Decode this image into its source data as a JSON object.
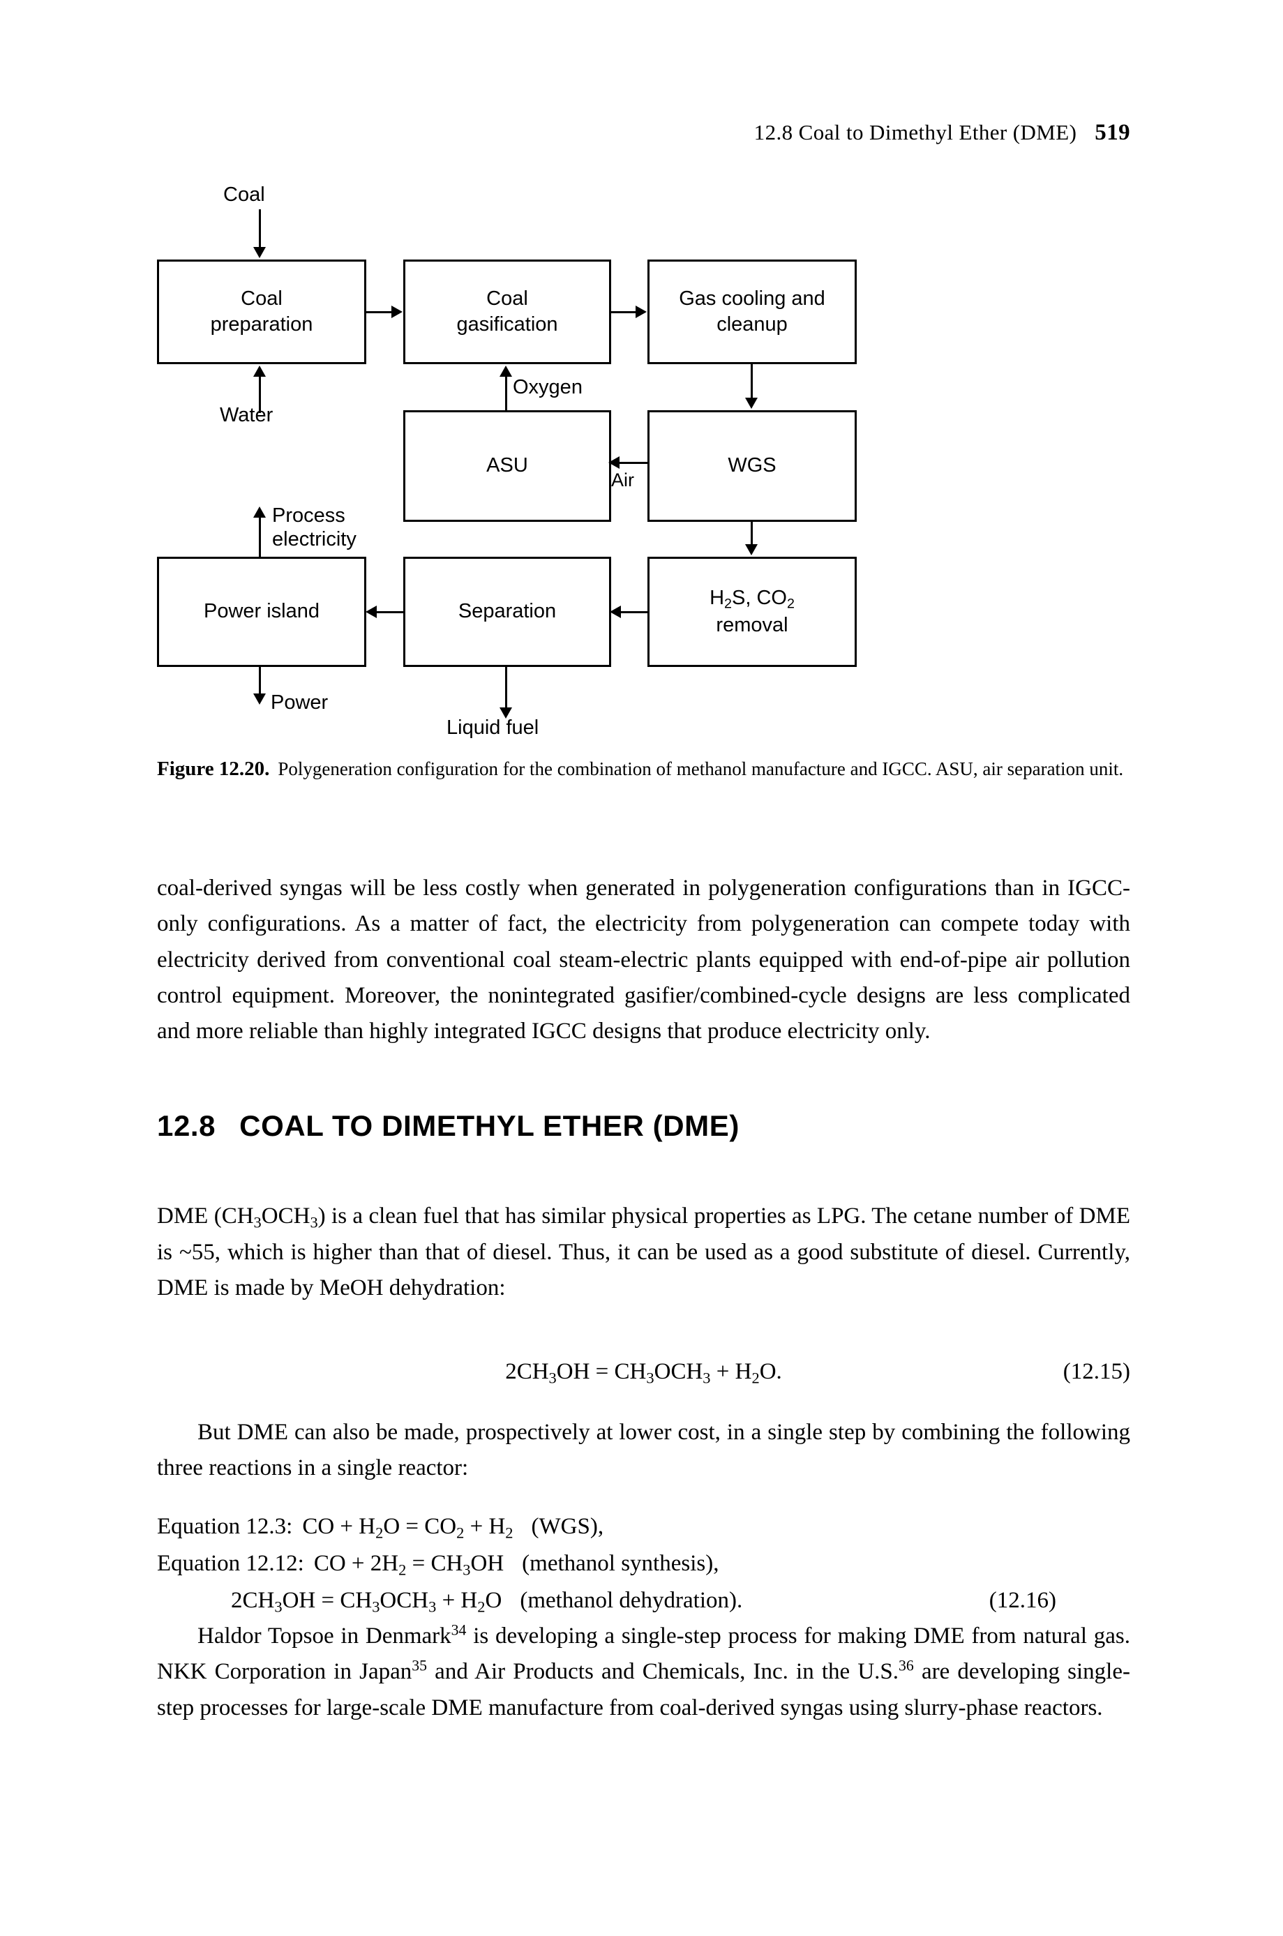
{
  "running_head": {
    "title": "12.8 Coal to Dimethyl Ether (DME)",
    "page_number": "519"
  },
  "figure": {
    "boxes": {
      "coal_preparation": "Coal\npreparation",
      "coal_gasification": "Coal\ngasification",
      "gas_cooling": "Gas cooling and\ncleanup",
      "asu": "ASU",
      "wgs": "WGS",
      "power_island": "Power island",
      "separation": "Separation",
      "h2s_co2_removal_line1": "removal"
    },
    "stream_labels": {
      "coal_in": "Coal",
      "water_in": "Water",
      "oxygen": "Oxygen",
      "air": "Air",
      "process_electricity": "Process\nelectricity",
      "power_out": "Power",
      "liquid_fuel_out": "Liquid fuel"
    },
    "caption": {
      "label": "Figure 12.20.",
      "text": "Polygeneration configuration for the combination of methanol manufacture and IGCC. ASU, air separation unit."
    }
  },
  "body": {
    "paragraph_1": "coal-derived syngas will be less costly when generated in polygeneration configurations than in IGCC-only configurations. As a matter of fact, the electricity from polygeneration can compete today with electricity derived from conventional coal steam-electric plants equipped with end-of-pipe air pollution control equipment. Moreover, the nonintegrated gasifier/combined-cycle designs are less complicated and more reliable than highly integrated IGCC designs that produce electricity only.",
    "paragraph_3": "But DME can also be made, prospectively at lower cost, in a single step by combining the following three reactions in a single reactor:"
  },
  "section": {
    "number": "12.8",
    "title": "COAL TO DIMETHYL ETHER (DME)"
  },
  "equations": {
    "eq_12_15": {
      "tag": "(12.15)"
    },
    "eq_12_16": {
      "tag": "(12.16)",
      "rows": [
        {
          "name": "Equation 12.3:",
          "note": "(WGS),"
        },
        {
          "name": "Equation 12.12:",
          "note": "(methanol synthesis),"
        },
        {
          "name": "",
          "note": "(methanol dehydration)."
        }
      ]
    }
  }
}
